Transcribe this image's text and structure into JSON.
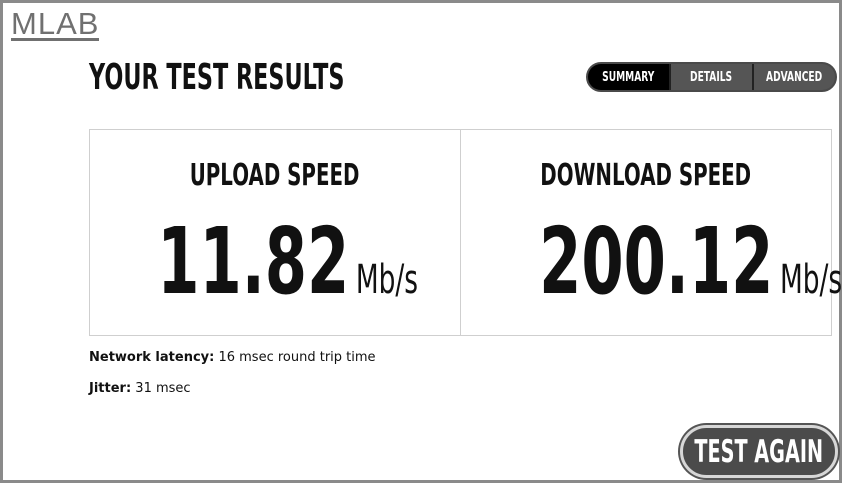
{
  "brand": {
    "logo_text": "MLAB"
  },
  "header": {
    "title": "YOUR TEST RESULTS"
  },
  "tabs": [
    {
      "label": "SUMMARY",
      "active": true
    },
    {
      "label": "DETAILS",
      "active": false
    },
    {
      "label": "ADVANCED",
      "active": false
    }
  ],
  "results": {
    "upload": {
      "label": "UPLOAD SPEED",
      "value": "11.82",
      "unit": "Mb/s"
    },
    "download": {
      "label": "DOWNLOAD SPEED",
      "value": "200.12",
      "unit": "Mb/s"
    }
  },
  "stats": {
    "latency": {
      "label": "Network latency:",
      "value": "16 msec round trip time"
    },
    "jitter": {
      "label": "Jitter:",
      "value": "31 msec"
    }
  },
  "actions": {
    "test_again_label": "TEST AGAIN"
  },
  "colors": {
    "frame": "#8a8a8a",
    "tab_active": "#000000",
    "tab_inactive": "#555555",
    "button_bg": "#4b4b4b",
    "text": "#111111"
  }
}
